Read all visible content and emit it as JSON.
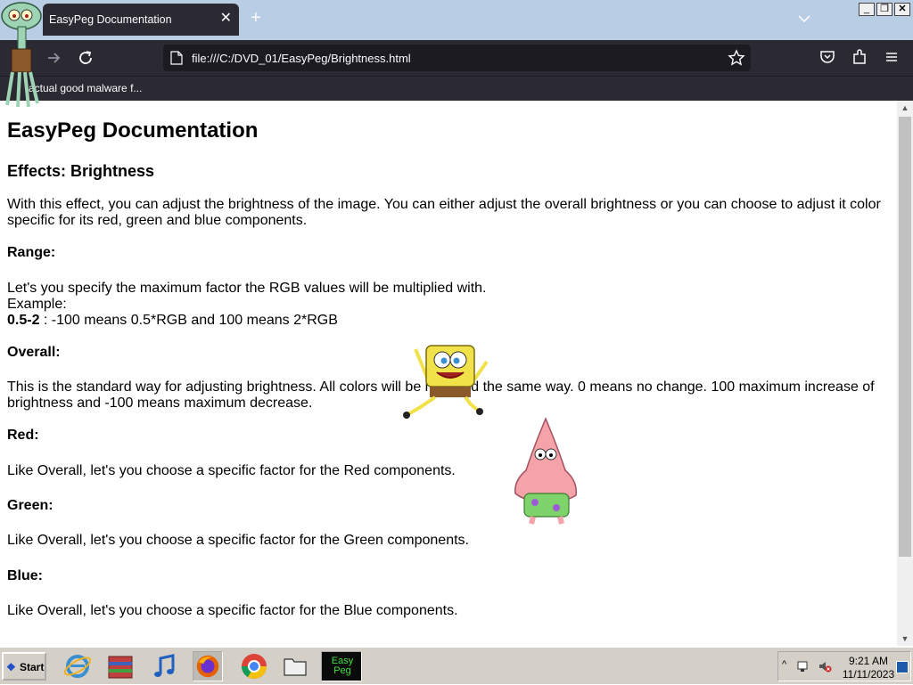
{
  "browser": {
    "tab_title": "EasyPeg Documentation",
    "tab_close": "✕",
    "new_tab": "+",
    "url": "file:///C:/DVD_01/EasyPeg/Brightness.html",
    "bookmark_1": "actual good malware f..."
  },
  "window_controls": {
    "minimize": "_",
    "maximize": "❐",
    "close": "✕"
  },
  "doc": {
    "title": "EasyPeg Documentation",
    "subtitle": "Effects: Brightness",
    "intro": "With this effect, you can adjust the brightness of the image. You can either adjust the overall brightness or you can choose to adjust it color specific for its red, green and blue components.",
    "range_heading": "Range:",
    "range_line1": "Let's you specify the maximum factor the RGB values will be multiplied with.",
    "range_line2": "Example:",
    "range_example_bold": "0.5-2",
    "range_example_rest": " : -100 means 0.5*RGB and 100 means 2*RGB",
    "overall_heading": "Overall:",
    "overall_text": "This is the standard way for adjusting brightness. All colors will be modified the same way. 0 means no change. 100 maximum increase of brightness and -100 means maximum decrease.",
    "red_heading": "Red:",
    "red_text": "Like Overall, let's you choose a specific factor for the Red components.",
    "green_heading": "Green:",
    "green_text": "Like Overall, let's you choose a specific factor for the Green components.",
    "blue_heading": "Blue:",
    "blue_text": "Like Overall, let's you choose a specific factor for the Blue components."
  },
  "taskbar": {
    "start_label": "Start",
    "easypeg_label": "Easy Peg",
    "clock_time": "9:21 AM",
    "clock_date": "11/11/2023"
  },
  "scrollbar": {
    "up_arrow": "▲",
    "down_arrow": "▼"
  },
  "colors": {
    "browser_chrome": "#2b2a33",
    "titlebar": "#b9cde5",
    "taskbar": "#d4d0c8"
  }
}
